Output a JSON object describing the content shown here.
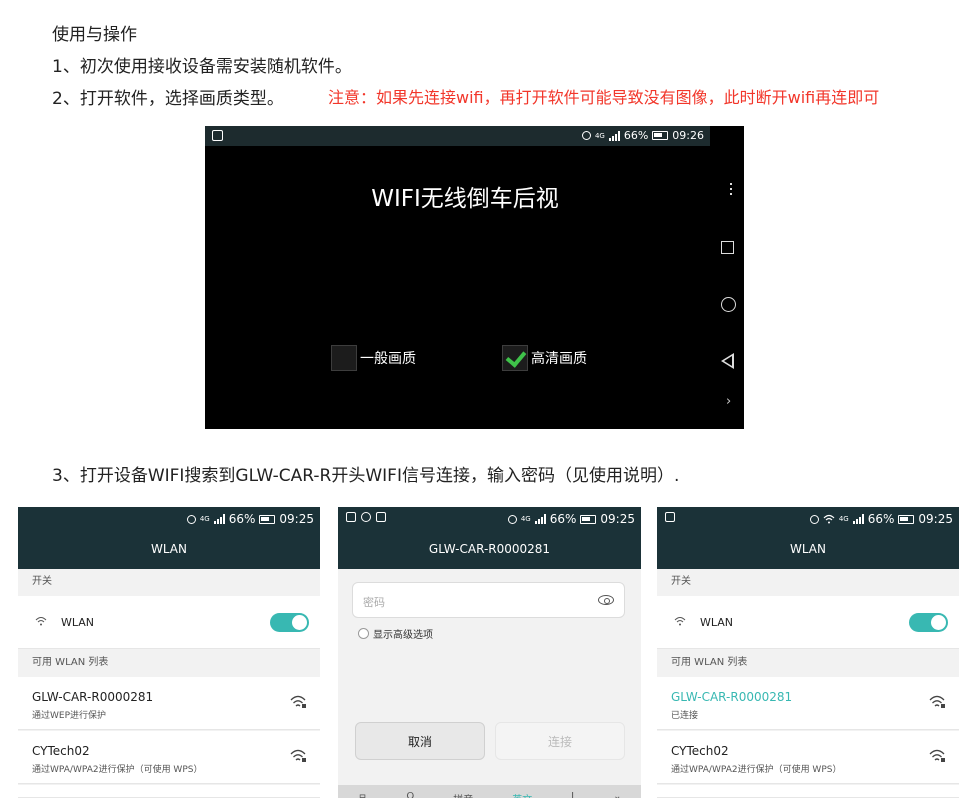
{
  "instructions": {
    "heading": "使用与操作",
    "step1": "1、初次使用接收设备需安装随机软件。",
    "step2": "2、打开软件，选择画质类型。",
    "note": "注意：如果先连接wifi，再打开软件可能导致没有图像，此时断开wifi再连即可",
    "step3": "3、打开设备WIFI搜索到GLW-CAR-R开头WIFI信号连接，输入密码（见使用说明）."
  },
  "app_screen": {
    "status": {
      "battery": "66%",
      "time": "09:26",
      "network": "4G"
    },
    "title": "WIFI无线倒车后视",
    "options": [
      {
        "label": "一般画质",
        "checked": false
      },
      {
        "label": "高清画质",
        "checked": true
      }
    ]
  },
  "screen_wlan1": {
    "status": {
      "battery": "66%",
      "time": "09:25",
      "network": "4G"
    },
    "title": "WLAN",
    "section_switch": "开关",
    "wlan_label": "WLAN",
    "wlan_enabled": true,
    "section_list": "可用 WLAN 列表",
    "networks": [
      {
        "name": "GLW-CAR-R0000281",
        "sub": "通过WEP进行保护"
      },
      {
        "name": "CYTech02",
        "sub": "通过WPA/WPA2进行保护（可使用 WPS）"
      }
    ]
  },
  "screen_password": {
    "status": {
      "battery": "66%",
      "time": "09:25",
      "network": "4G"
    },
    "title": "GLW-CAR-R0000281",
    "password_placeholder": "密码",
    "advanced_label": "显示高级选项",
    "cancel_label": "取消",
    "connect_label": "连接",
    "keyboard_items": [
      "品",
      "Q",
      "拼音",
      "英文",
      "I",
      "⌄"
    ]
  },
  "screen_wlan2": {
    "status": {
      "battery": "66%",
      "time": "09:25",
      "network": "4G"
    },
    "title": "WLAN",
    "section_switch": "开关",
    "wlan_label": "WLAN",
    "wlan_enabled": true,
    "section_list": "可用 WLAN 列表",
    "networks": [
      {
        "name": "GLW-CAR-R0000281",
        "sub": "已连接"
      },
      {
        "name": "CYTech02",
        "sub": "通过WPA/WPA2进行保护（可使用 WPS）"
      }
    ]
  },
  "colors": {
    "accent": "#38b8b2",
    "note": "#f2362a",
    "header": "#1b3238"
  }
}
